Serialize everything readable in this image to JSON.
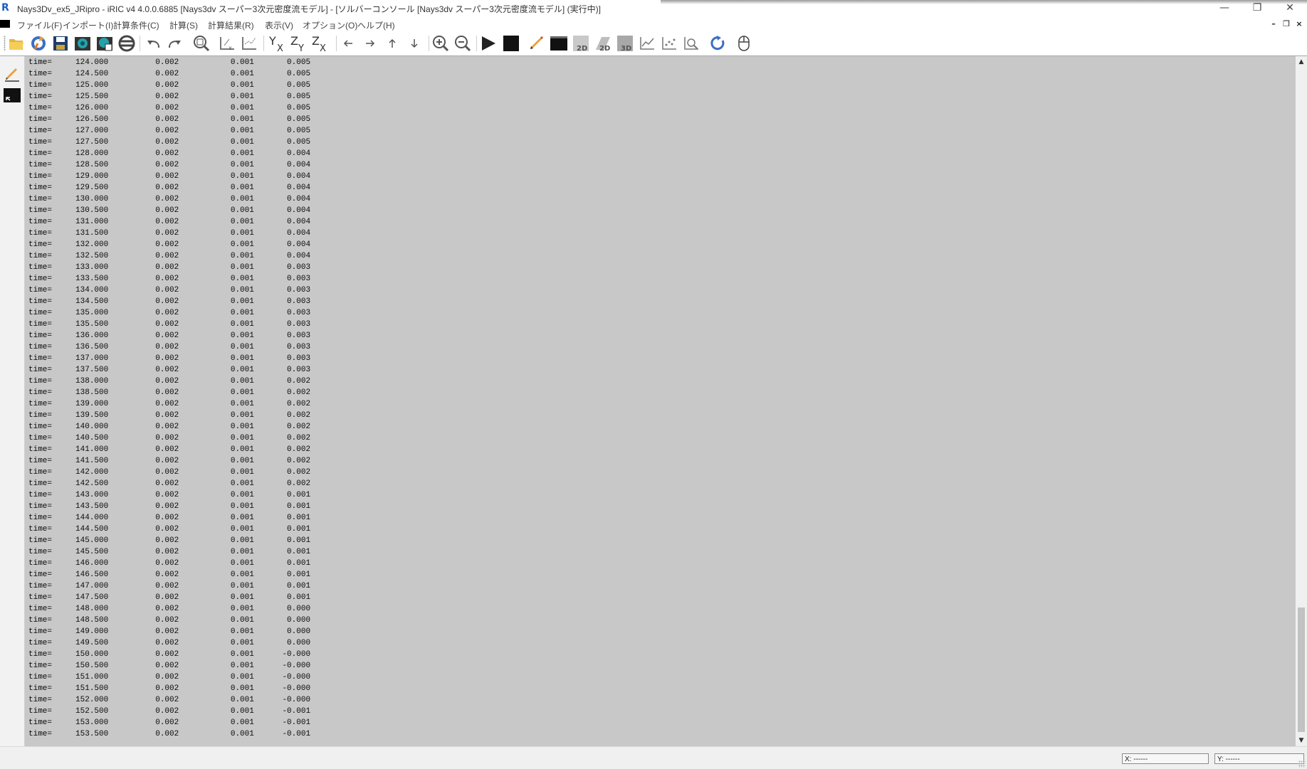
{
  "window": {
    "title": "Nays3Dv_ex5_JRipro - iRIC v4 4.0.0.6885 [Nays3dv スーパー3次元密度流モデル] - [ソルバーコンソール [Nays3dv スーパー3次元密度流モデル] (実行中)]",
    "app_icon_glyph": "R",
    "minimize_glyph": "—",
    "restore_glyph": "❐",
    "close_glyph": "✕"
  },
  "menubar": {
    "items": [
      {
        "label": "ファイル(F)"
      },
      {
        "label": "インポート(I)"
      },
      {
        "label": "計算条件(C)"
      },
      {
        "label": "計算(S)"
      },
      {
        "label": "計算結果(R)"
      },
      {
        "label": "表示(V)"
      },
      {
        "label": "オプション(O)"
      },
      {
        "label": "ヘルプ(H)"
      }
    ],
    "mdi_minimize_glyph": "–",
    "mdi_restore_glyph": "❐",
    "mdi_close_glyph": "×"
  },
  "toolbar": {
    "icons": [
      "open-folder-icon",
      "reload-icon",
      "save-icon",
      "camera-icon",
      "snapshot-icon",
      "circle-slash-icon",
      "undo-icon",
      "redo-icon",
      "fit-view-icon",
      "axis-x-icon",
      "axis-zoom-icon",
      "yx-axis-icon",
      "zy-axis-icon",
      "zx-axis-icon",
      "arrow-left-icon",
      "arrow-right-icon",
      "arrow-up-icon",
      "arrow-down-icon",
      "zoom-in-icon",
      "zoom-out-icon",
      "run-icon",
      "stop-icon",
      "pencil-icon",
      "console-icon",
      "post-2d-icon",
      "post-2d-bird-icon",
      "post-3d-icon",
      "graph-icon",
      "scatter-icon",
      "zoom-graph-icon",
      "refresh-icon",
      "mouse-icon"
    ],
    "label_2d": "2D",
    "label_3d": "3D",
    "label_y": "Y",
    "label_z": "Z",
    "label_x": "X"
  },
  "leftbar": {
    "icons": [
      "edit-pencil-icon",
      "console-window-icon"
    ]
  },
  "console": {
    "lines": [
      {
        "label": "time=",
        "t": "124.000",
        "a": "0.002",
        "b": "0.001",
        "c": "0.005"
      },
      {
        "label": "time=",
        "t": "124.500",
        "a": "0.002",
        "b": "0.001",
        "c": "0.005"
      },
      {
        "label": "time=",
        "t": "125.000",
        "a": "0.002",
        "b": "0.001",
        "c": "0.005"
      },
      {
        "label": "time=",
        "t": "125.500",
        "a": "0.002",
        "b": "0.001",
        "c": "0.005"
      },
      {
        "label": "time=",
        "t": "126.000",
        "a": "0.002",
        "b": "0.001",
        "c": "0.005"
      },
      {
        "label": "time=",
        "t": "126.500",
        "a": "0.002",
        "b": "0.001",
        "c": "0.005"
      },
      {
        "label": "time=",
        "t": "127.000",
        "a": "0.002",
        "b": "0.001",
        "c": "0.005"
      },
      {
        "label": "time=",
        "t": "127.500",
        "a": "0.002",
        "b": "0.001",
        "c": "0.005"
      },
      {
        "label": "time=",
        "t": "128.000",
        "a": "0.002",
        "b": "0.001",
        "c": "0.004"
      },
      {
        "label": "time=",
        "t": "128.500",
        "a": "0.002",
        "b": "0.001",
        "c": "0.004"
      },
      {
        "label": "time=",
        "t": "129.000",
        "a": "0.002",
        "b": "0.001",
        "c": "0.004"
      },
      {
        "label": "time=",
        "t": "129.500",
        "a": "0.002",
        "b": "0.001",
        "c": "0.004"
      },
      {
        "label": "time=",
        "t": "130.000",
        "a": "0.002",
        "b": "0.001",
        "c": "0.004"
      },
      {
        "label": "time=",
        "t": "130.500",
        "a": "0.002",
        "b": "0.001",
        "c": "0.004"
      },
      {
        "label": "time=",
        "t": "131.000",
        "a": "0.002",
        "b": "0.001",
        "c": "0.004"
      },
      {
        "label": "time=",
        "t": "131.500",
        "a": "0.002",
        "b": "0.001",
        "c": "0.004"
      },
      {
        "label": "time=",
        "t": "132.000",
        "a": "0.002",
        "b": "0.001",
        "c": "0.004"
      },
      {
        "label": "time=",
        "t": "132.500",
        "a": "0.002",
        "b": "0.001",
        "c": "0.004"
      },
      {
        "label": "time=",
        "t": "133.000",
        "a": "0.002",
        "b": "0.001",
        "c": "0.003"
      },
      {
        "label": "time=",
        "t": "133.500",
        "a": "0.002",
        "b": "0.001",
        "c": "0.003"
      },
      {
        "label": "time=",
        "t": "134.000",
        "a": "0.002",
        "b": "0.001",
        "c": "0.003"
      },
      {
        "label": "time=",
        "t": "134.500",
        "a": "0.002",
        "b": "0.001",
        "c": "0.003"
      },
      {
        "label": "time=",
        "t": "135.000",
        "a": "0.002",
        "b": "0.001",
        "c": "0.003"
      },
      {
        "label": "time=",
        "t": "135.500",
        "a": "0.002",
        "b": "0.001",
        "c": "0.003"
      },
      {
        "label": "time=",
        "t": "136.000",
        "a": "0.002",
        "b": "0.001",
        "c": "0.003"
      },
      {
        "label": "time=",
        "t": "136.500",
        "a": "0.002",
        "b": "0.001",
        "c": "0.003"
      },
      {
        "label": "time=",
        "t": "137.000",
        "a": "0.002",
        "b": "0.001",
        "c": "0.003"
      },
      {
        "label": "time=",
        "t": "137.500",
        "a": "0.002",
        "b": "0.001",
        "c": "0.003"
      },
      {
        "label": "time=",
        "t": "138.000",
        "a": "0.002",
        "b": "0.001",
        "c": "0.002"
      },
      {
        "label": "time=",
        "t": "138.500",
        "a": "0.002",
        "b": "0.001",
        "c": "0.002"
      },
      {
        "label": "time=",
        "t": "139.000",
        "a": "0.002",
        "b": "0.001",
        "c": "0.002"
      },
      {
        "label": "time=",
        "t": "139.500",
        "a": "0.002",
        "b": "0.001",
        "c": "0.002"
      },
      {
        "label": "time=",
        "t": "140.000",
        "a": "0.002",
        "b": "0.001",
        "c": "0.002"
      },
      {
        "label": "time=",
        "t": "140.500",
        "a": "0.002",
        "b": "0.001",
        "c": "0.002"
      },
      {
        "label": "time=",
        "t": "141.000",
        "a": "0.002",
        "b": "0.001",
        "c": "0.002"
      },
      {
        "label": "time=",
        "t": "141.500",
        "a": "0.002",
        "b": "0.001",
        "c": "0.002"
      },
      {
        "label": "time=",
        "t": "142.000",
        "a": "0.002",
        "b": "0.001",
        "c": "0.002"
      },
      {
        "label": "time=",
        "t": "142.500",
        "a": "0.002",
        "b": "0.001",
        "c": "0.002"
      },
      {
        "label": "time=",
        "t": "143.000",
        "a": "0.002",
        "b": "0.001",
        "c": "0.001"
      },
      {
        "label": "time=",
        "t": "143.500",
        "a": "0.002",
        "b": "0.001",
        "c": "0.001"
      },
      {
        "label": "time=",
        "t": "144.000",
        "a": "0.002",
        "b": "0.001",
        "c": "0.001"
      },
      {
        "label": "time=",
        "t": "144.500",
        "a": "0.002",
        "b": "0.001",
        "c": "0.001"
      },
      {
        "label": "time=",
        "t": "145.000",
        "a": "0.002",
        "b": "0.001",
        "c": "0.001"
      },
      {
        "label": "time=",
        "t": "145.500",
        "a": "0.002",
        "b": "0.001",
        "c": "0.001"
      },
      {
        "label": "time=",
        "t": "146.000",
        "a": "0.002",
        "b": "0.001",
        "c": "0.001"
      },
      {
        "label": "time=",
        "t": "146.500",
        "a": "0.002",
        "b": "0.001",
        "c": "0.001"
      },
      {
        "label": "time=",
        "t": "147.000",
        "a": "0.002",
        "b": "0.001",
        "c": "0.001"
      },
      {
        "label": "time=",
        "t": "147.500",
        "a": "0.002",
        "b": "0.001",
        "c": "0.001"
      },
      {
        "label": "time=",
        "t": "148.000",
        "a": "0.002",
        "b": "0.001",
        "c": "0.000"
      },
      {
        "label": "time=",
        "t": "148.500",
        "a": "0.002",
        "b": "0.001",
        "c": "0.000"
      },
      {
        "label": "time=",
        "t": "149.000",
        "a": "0.002",
        "b": "0.001",
        "c": "0.000"
      },
      {
        "label": "time=",
        "t": "149.500",
        "a": "0.002",
        "b": "0.001",
        "c": "0.000"
      },
      {
        "label": "time=",
        "t": "150.000",
        "a": "0.002",
        "b": "0.001",
        "c": "-0.000"
      },
      {
        "label": "time=",
        "t": "150.500",
        "a": "0.002",
        "b": "0.001",
        "c": "-0.000"
      },
      {
        "label": "time=",
        "t": "151.000",
        "a": "0.002",
        "b": "0.001",
        "c": "-0.000"
      },
      {
        "label": "time=",
        "t": "151.500",
        "a": "0.002",
        "b": "0.001",
        "c": "-0.000"
      },
      {
        "label": "time=",
        "t": "152.000",
        "a": "0.002",
        "b": "0.001",
        "c": "-0.000"
      },
      {
        "label": "time=",
        "t": "152.500",
        "a": "0.002",
        "b": "0.001",
        "c": "-0.001"
      },
      {
        "label": "time=",
        "t": "153.000",
        "a": "0.002",
        "b": "0.001",
        "c": "-0.001"
      },
      {
        "label": "time=",
        "t": "153.500",
        "a": "0.002",
        "b": "0.001",
        "c": "-0.001"
      }
    ]
  },
  "scrollbar": {
    "up_glyph": "▲",
    "down_glyph": "▼",
    "position": 0.83
  },
  "statusbar": {
    "x_label": "X: ------",
    "y_label": "Y: ------"
  },
  "colors": {
    "console_bg": "#c8c8c8",
    "console_text": "#0a0a0a",
    "chrome_bg": "#f0f0f0"
  }
}
